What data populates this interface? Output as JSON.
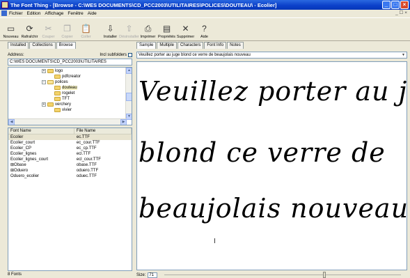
{
  "window": {
    "title": "The Font Thing - [Browse - C:\\WES DOCUMENTS\\CD_PCC2003\\UTILITAIRES\\POLICES\\DOUTEAU\\ - Ecolier]",
    "minimize": "_",
    "maximize": "□",
    "close": "×"
  },
  "menubar": {
    "items": [
      "Fichier",
      "Edition",
      "Affichage",
      "Fenêtre",
      "Aide"
    ],
    "mdi_controls": "_ ☐ ×"
  },
  "toolbar": {
    "buttons": [
      {
        "label": "Nouveau",
        "icon": "new-window-icon",
        "glyph": "▭",
        "disabled": false
      },
      {
        "label": "Rafraîchir",
        "icon": "refresh-icon",
        "glyph": "⟳",
        "disabled": false
      },
      {
        "label": "Couper",
        "icon": "cut-icon",
        "glyph": "✂",
        "disabled": true
      },
      {
        "label": "Copier",
        "icon": "copy-icon",
        "glyph": "❐",
        "disabled": true
      },
      {
        "label": "Coller",
        "icon": "paste-icon",
        "glyph": "📋",
        "disabled": true
      },
      {
        "label": "Installer",
        "icon": "install-icon",
        "glyph": "⇩",
        "disabled": false
      },
      {
        "label": "Désinstaller",
        "icon": "uninstall-icon",
        "glyph": "⇧",
        "disabled": true
      },
      {
        "label": "Imprimer",
        "icon": "print-icon",
        "glyph": "⎙",
        "disabled": false
      },
      {
        "label": "Propriétés",
        "icon": "properties-icon",
        "glyph": "▤",
        "disabled": false
      },
      {
        "label": "Supprimer",
        "icon": "delete-icon",
        "glyph": "✕",
        "disabled": false
      },
      {
        "label": "Aide",
        "icon": "help-icon",
        "glyph": "?",
        "disabled": false
      }
    ]
  },
  "left": {
    "tabs": [
      "Installed",
      "Collections",
      "Browse"
    ],
    "active_tab": "Browse",
    "address_label": "Address:",
    "include_subfolders": "Incl subfolders",
    "address_value": "C:\\WES DOCUMENTS\\CD_PCC2003\\UTILITAIRES",
    "tree": [
      {
        "label": "logo",
        "expander": "+"
      },
      {
        "label": "pdfcreator",
        "expander": ""
      },
      {
        "label": "polices",
        "expander": "−"
      },
      {
        "label": "douteau",
        "expander": ""
      },
      {
        "label": "rogelet",
        "expander": ""
      },
      {
        "label": "TFT",
        "expander": ""
      },
      {
        "label": "verchery",
        "expander": "+"
      },
      {
        "label": "vivier",
        "expander": ""
      }
    ],
    "columns": [
      "Font Name",
      "File Name"
    ],
    "fonts": [
      {
        "name": "Ecolier",
        "file": "ec.TTF",
        "prefix": ""
      },
      {
        "name": "Ecolier_court",
        "file": "ec_cour.TTF",
        "prefix": ""
      },
      {
        "name": "Ecolier_CP",
        "file": "ec_cp.TTF",
        "prefix": ""
      },
      {
        "name": "Ecolier_lignes",
        "file": "ecl.TTF",
        "prefix": ""
      },
      {
        "name": "Ecolier_lignes_court",
        "file": "ecl_cour.TTF",
        "prefix": ""
      },
      {
        "name": "Obase",
        "file": "obase.TTF",
        "prefix": "⊞"
      },
      {
        "name": "Oduero",
        "file": "oduero.TTF",
        "prefix": "⊞"
      },
      {
        "name": "Oduero_ecolier",
        "file": "oduec.TTF",
        "prefix": ""
      }
    ],
    "status": "8 Fonts"
  },
  "right": {
    "tabs": [
      "Sample",
      "Multiple",
      "Characters",
      "Font Info",
      "Notes"
    ],
    "active_tab": "Sample",
    "sample_text": "Veuillez porter au juge blond ce verre de beaujolais nouveau",
    "preview_lines": [
      "Veuillez porter au juge",
      "blond ce verre de",
      "beaujolais nouveau"
    ],
    "size_label": "Size:",
    "size_value": "71",
    "size_fraction": 0.67
  }
}
